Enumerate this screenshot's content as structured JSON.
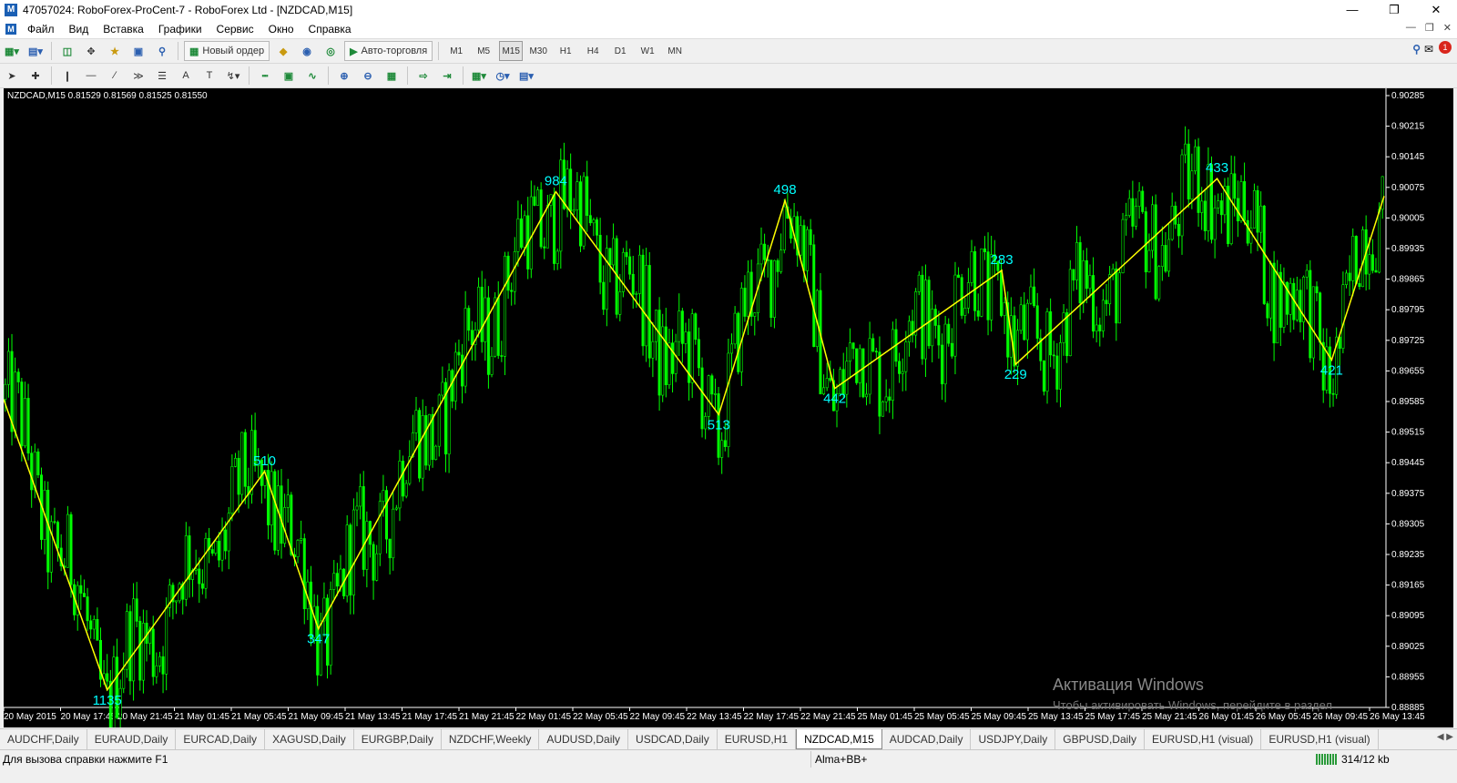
{
  "window": {
    "title": "47057024: RoboForex-ProCent-7 - RoboForex Ltd - [NZDCAD,M15]",
    "app_icon": "metatrader-icon"
  },
  "menu": [
    "Файл",
    "Вид",
    "Вставка",
    "Графики",
    "Сервис",
    "Окно",
    "Справка"
  ],
  "toolbar": {
    "new_order_label": "Новый ордер",
    "autotrade_label": "Авто-торговля",
    "timeframes": [
      "M1",
      "M5",
      "M15",
      "M30",
      "H1",
      "H4",
      "D1",
      "W1",
      "MN"
    ],
    "active_timeframe": "M15",
    "notification_count": "1"
  },
  "chart": {
    "info_line": "NZDCAD,M15  0.81529 0.81569 0.81525 0.81550",
    "background": "#000000",
    "candle_color": "#00ff00",
    "zigzag_color": "#ffff00",
    "label_color": "#00ffff"
  },
  "chart_data": {
    "type": "line",
    "symbol": "NZDCAD,M15",
    "price_ticks": [
      "0.90285",
      "0.90215",
      "0.90145",
      "0.90075",
      "0.90005",
      "0.89935",
      "0.89865",
      "0.89795",
      "0.89725",
      "0.89655",
      "0.89585",
      "0.89515",
      "0.89445",
      "0.89375",
      "0.89305",
      "0.89235",
      "0.89165",
      "0.89095",
      "0.89025",
      "0.88955",
      "0.88885"
    ],
    "ylim": [
      0.88885,
      0.90285
    ],
    "time_ticks": [
      "20 May 2015",
      "20 May 17:45",
      "20 May 21:45",
      "21 May 01:45",
      "21 May 05:45",
      "21 May 09:45",
      "21 May 13:45",
      "21 May 17:45",
      "21 May 21:45",
      "22 May 01:45",
      "22 May 05:45",
      "22 May 09:45",
      "22 May 13:45",
      "22 May 17:45",
      "22 May 21:45",
      "25 May 01:45",
      "25 May 05:45",
      "25 May 09:45",
      "25 May 13:45",
      "25 May 17:45",
      "25 May 21:45",
      "26 May 01:45",
      "26 May 05:45",
      "26 May 09:45",
      "26 May 13:45"
    ],
    "zigzag": [
      {
        "t": 0.0,
        "price": 0.8959,
        "label": ""
      },
      {
        "t": 0.075,
        "price": 0.88925,
        "label": "1135"
      },
      {
        "t": 0.189,
        "price": 0.89425,
        "label": "510"
      },
      {
        "t": 0.228,
        "price": 0.89065,
        "label": "347"
      },
      {
        "t": 0.4,
        "price": 0.90065,
        "label": "984"
      },
      {
        "t": 0.518,
        "price": 0.89555,
        "label": "513"
      },
      {
        "t": 0.566,
        "price": 0.90045,
        "label": "498"
      },
      {
        "t": 0.602,
        "price": 0.89615,
        "label": "442"
      },
      {
        "t": 0.723,
        "price": 0.89885,
        "label": "283"
      },
      {
        "t": 0.733,
        "price": 0.8967,
        "label": "229"
      },
      {
        "t": 0.879,
        "price": 0.90095,
        "label": "433"
      },
      {
        "t": 0.962,
        "price": 0.8968,
        "label": "421"
      },
      {
        "t": 1.0,
        "price": 0.90055,
        "label": ""
      }
    ]
  },
  "watermark": {
    "title": "Активация Windows",
    "subtitle": "Чтобы активировать Windows, перейдите в раздел"
  },
  "tabs": [
    "AUDCHF,Daily",
    "EURAUD,Daily",
    "EURCAD,Daily",
    "XAGUSD,Daily",
    "EURGBP,Daily",
    "NZDCHF,Weekly",
    "AUDUSD,Daily",
    "USDCAD,Daily",
    "EURUSD,H1",
    "NZDCAD,M15",
    "AUDCAD,Daily",
    "USDJPY,Daily",
    "GBPUSD,Daily",
    "EURUSD,H1 (visual)",
    "EURUSD,H1 (visual)"
  ],
  "active_tab": "NZDCAD,M15",
  "status": {
    "help": "Для вызова справки нажмите F1",
    "profile": "Alma+BB+",
    "traffic": "314/12 kb"
  }
}
